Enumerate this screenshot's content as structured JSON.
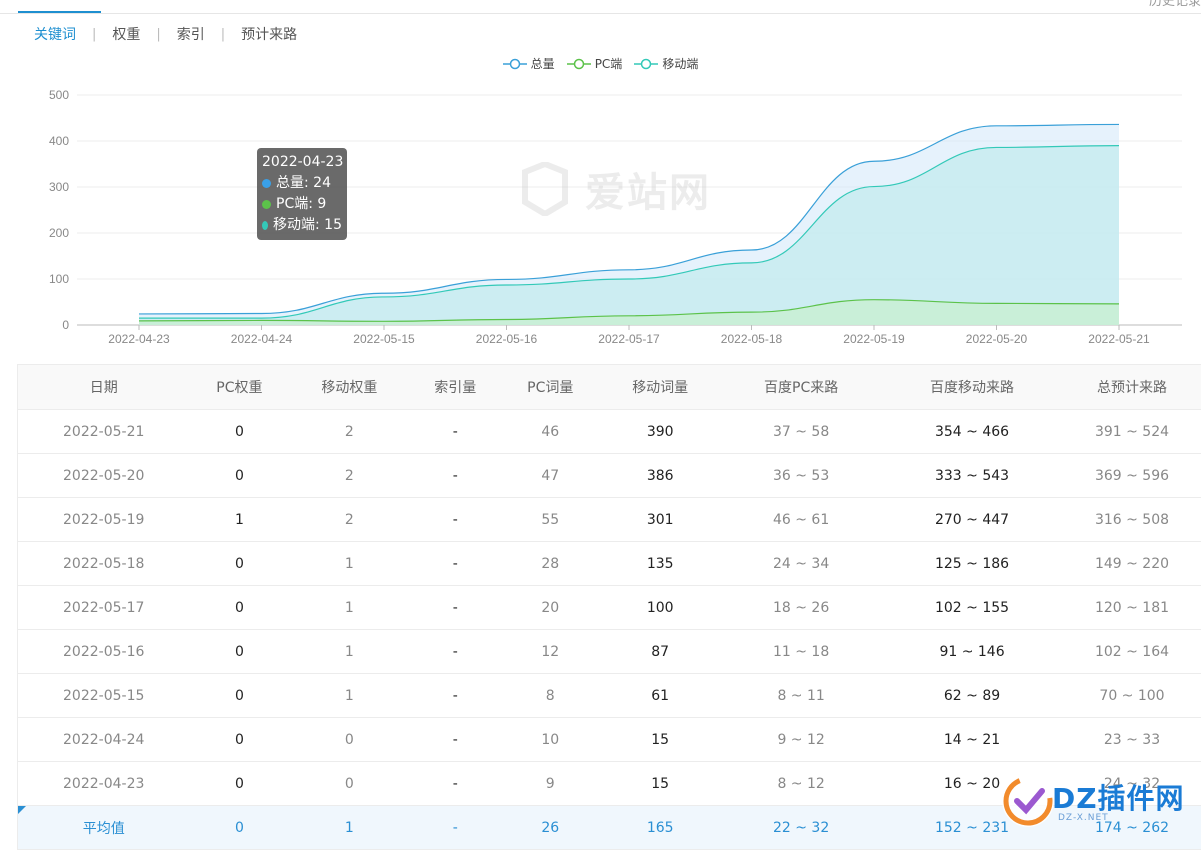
{
  "tabs": [
    "关键词",
    "权重",
    "索引",
    "预计来路"
  ],
  "corner_text": "历史记录",
  "watermark_text": "爱站网",
  "legend": [
    {
      "name": "总量",
      "color": "#3aa0d8"
    },
    {
      "name": "PC端",
      "color": "#5cc24a"
    },
    {
      "name": "移动端",
      "color": "#33c9b8"
    }
  ],
  "tooltip": {
    "date": "2022-04-23",
    "rows": [
      {
        "label": "总量: 24",
        "color": "#3aa0e8"
      },
      {
        "label": "PC端: 9",
        "color": "#5cc24a"
      },
      {
        "label": "移动端: 15",
        "color": "#33c9b8"
      }
    ]
  },
  "chart_data": {
    "type": "area",
    "x": [
      "2022-04-23",
      "2022-04-24",
      "2022-05-15",
      "2022-05-16",
      "2022-05-17",
      "2022-05-18",
      "2022-05-19",
      "2022-05-20",
      "2022-05-21"
    ],
    "series": [
      {
        "name": "总量",
        "values": [
          24,
          25,
          69,
          99,
          120,
          163,
          356,
          433,
          436
        ]
      },
      {
        "name": "PC端",
        "values": [
          9,
          10,
          8,
          12,
          20,
          28,
          55,
          47,
          46
        ]
      },
      {
        "name": "移动端",
        "values": [
          15,
          15,
          61,
          87,
          100,
          135,
          301,
          386,
          390
        ]
      }
    ],
    "ylim": [
      0,
      500
    ],
    "yticks": [
      0,
      100,
      200,
      300,
      400,
      500
    ],
    "grid": true,
    "legend_position": "top-center"
  },
  "table": {
    "headers": [
      "日期",
      "PC权重",
      "移动权重",
      "索引量",
      "PC词量",
      "移动词量",
      "百度PC来路",
      "百度移动来路",
      "总预计来路"
    ],
    "rows": [
      [
        "2022-05-21",
        "0",
        "2",
        "-",
        "46",
        "390",
        "37 ~ 58",
        "354 ~ 466",
        "391 ~ 524"
      ],
      [
        "2022-05-20",
        "0",
        "2",
        "-",
        "47",
        "386",
        "36 ~ 53",
        "333 ~ 543",
        "369 ~ 596"
      ],
      [
        "2022-05-19",
        "1",
        "2",
        "-",
        "55",
        "301",
        "46 ~ 61",
        "270 ~ 447",
        "316 ~ 508"
      ],
      [
        "2022-05-18",
        "0",
        "1",
        "-",
        "28",
        "135",
        "24 ~ 34",
        "125 ~ 186",
        "149 ~ 220"
      ],
      [
        "2022-05-17",
        "0",
        "1",
        "-",
        "20",
        "100",
        "18 ~ 26",
        "102 ~ 155",
        "120 ~ 181"
      ],
      [
        "2022-05-16",
        "0",
        "1",
        "-",
        "12",
        "87",
        "11 ~ 18",
        "91 ~ 146",
        "102 ~ 164"
      ],
      [
        "2022-05-15",
        "0",
        "1",
        "-",
        "8",
        "61",
        "8 ~ 11",
        "62 ~ 89",
        "70 ~ 100"
      ],
      [
        "2022-04-24",
        "0",
        "0",
        "-",
        "10",
        "15",
        "9 ~ 12",
        "14 ~ 21",
        "23 ~ 33"
      ],
      [
        "2022-04-23",
        "0",
        "0",
        "-",
        "9",
        "15",
        "8 ~ 12",
        "16 ~ 20",
        "24 ~ 32"
      ]
    ],
    "average": [
      "平均值",
      "0",
      "1",
      "-",
      "26",
      "165",
      "22 ~ 32",
      "152 ~ 231",
      "174 ~ 262"
    ]
  },
  "logo": {
    "text": "DZ插件网",
    "sub": "DZ-X.NET"
  }
}
